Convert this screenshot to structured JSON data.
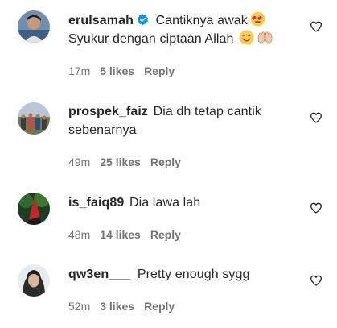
{
  "comments": [
    {
      "username": "erulsamah",
      "verified": true,
      "text_line1": "Cantiknya awak",
      "text_line2": "Syukur dengan ciptaan Allah",
      "time": "17m",
      "likes": "5 likes",
      "reply": "Reply",
      "emojis_line1": [
        "heart-eyes-emoji"
      ],
      "emojis_line2": [
        "smiling-face-emoji",
        "palms-up-emoji"
      ]
    },
    {
      "username": "prospek_faiz",
      "text_line1": "Dia dh tetap cantik",
      "text_line2": "sebenarnya",
      "time": "49m",
      "likes": "25 likes",
      "reply": "Reply"
    },
    {
      "username": "is_faiq89",
      "text_line1": "Dia lawa lah",
      "time": "48m",
      "likes": "14 likes",
      "reply": "Reply"
    },
    {
      "username": "qw3en___",
      "text_line1": "Pretty enough sygg",
      "time": "52m",
      "likes": "3 likes",
      "reply": "Reply"
    }
  ],
  "icons": {
    "like": "heart-outline-icon",
    "verified": "verified-badge-icon"
  },
  "colors": {
    "text": "#262626",
    "muted": "#737373",
    "verified": "#0095f6"
  }
}
